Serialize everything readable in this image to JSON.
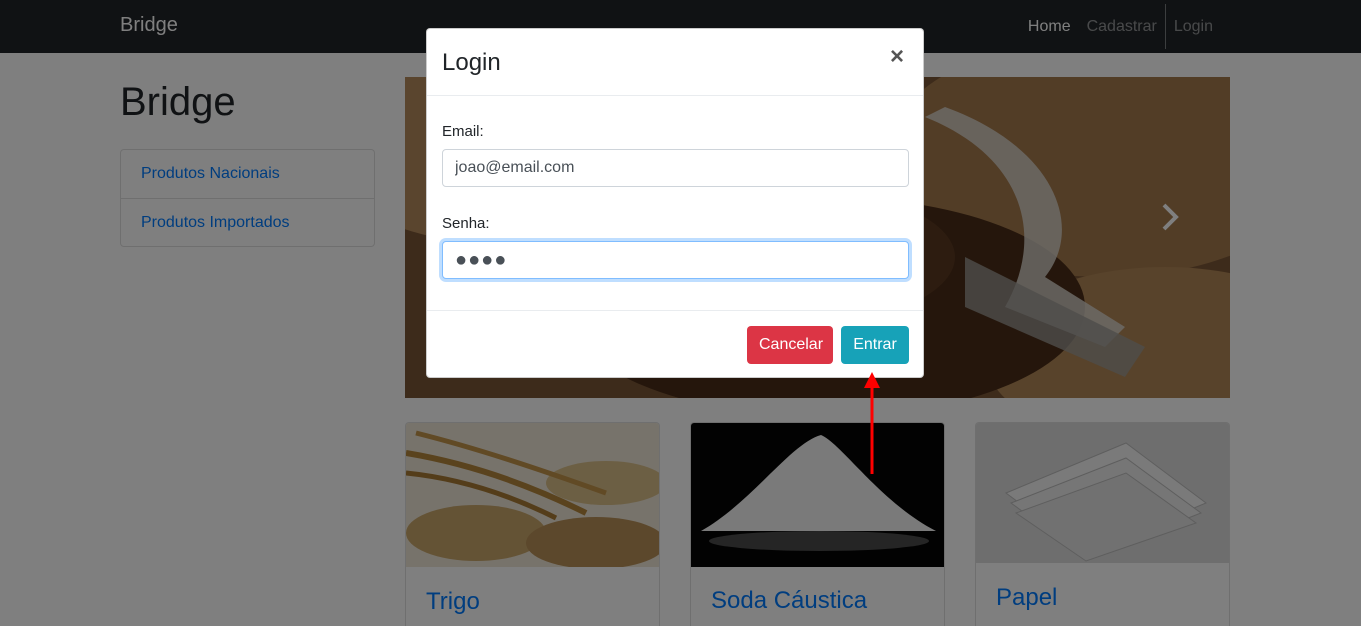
{
  "navbar": {
    "brand": "Bridge",
    "links": [
      {
        "label": "Home",
        "active": true
      },
      {
        "label": "Cadastrar",
        "active": false
      },
      {
        "label": "Login",
        "active": false
      }
    ]
  },
  "page": {
    "title": "Bridge",
    "categories": [
      {
        "label": "Produtos Nacionais"
      },
      {
        "label": "Produtos Importados"
      }
    ],
    "carousel": {
      "image": "coffee-beans-burlap-photo",
      "next_icon": "chevron-right-icon"
    },
    "products": [
      {
        "title": "Trigo",
        "image": "wheat-photo"
      },
      {
        "title": "Soda Cáustica",
        "image": "white-powder-photo"
      },
      {
        "title": "Papel",
        "image": "paper-stack-photo"
      }
    ]
  },
  "modal": {
    "title": "Login",
    "close_icon": "close-icon",
    "email": {
      "label": "Email:",
      "value": "joao@email.com"
    },
    "password": {
      "label": "Senha:",
      "value": "●●●●"
    },
    "buttons": {
      "cancel": "Cancelar",
      "submit": "Entrar"
    }
  },
  "annotation": {
    "arrow_color": "#ff0000"
  },
  "colors": {
    "navbar": "#212529",
    "link": "#007bff",
    "danger": "#dc3545",
    "info": "#17a2b8"
  }
}
